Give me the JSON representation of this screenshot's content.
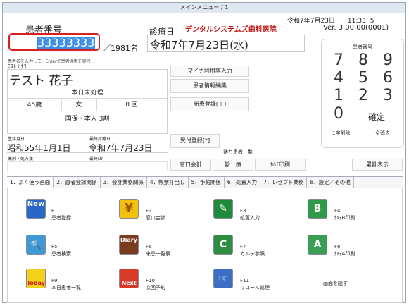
{
  "window": {
    "title": "メインメニュー / 1"
  },
  "header": {
    "date_time": "令和7年7月23日　　11:33: 5",
    "version": "Ver. 3.00.00(0001)",
    "clinic_name": "デンタルシステムズ歯科医院",
    "consult_date_label": "診療日",
    "consult_date": "令和7年7月23日(水)"
  },
  "patient": {
    "number_label": "患者番号",
    "number_value": "33333333",
    "total_count": "／1981名",
    "hint": "患者名を入力して、Enterで患者検索を実行",
    "kana": "ﾃｽﾄ ﾊﾅｺ",
    "name": "テスト 花子",
    "status": "本日未処理",
    "age": "45歳",
    "sex": "女",
    "visits": "0 回",
    "insurance": "国保・本人 3割",
    "birth_label": "生年月日",
    "birth": "昭和55年1月1日",
    "last_visit_label": "最終診療日",
    "last_visit": "令和7年7月23日",
    "disease_label": "薬剤・処方箋",
    "doctor_label": "最終Dr."
  },
  "buttons": {
    "mynumber": "マイナ利用率入力",
    "patient_edit": "患者情報編集",
    "new_patient": "新患登録[＋]",
    "reception": "受付登録[*]",
    "waiting_title": "待ち患者一覧",
    "window_pay": "窓口会計",
    "consult": "診　療",
    "karte_print": "ｶﾙﾃ印刷",
    "cumulative": "累計表示"
  },
  "keypad": {
    "label": "患者番号",
    "keys": [
      "7",
      "8",
      "9",
      "4",
      "5",
      "6",
      "1",
      "2",
      "3",
      "0",
      "確定"
    ],
    "delete_one": "1字削除",
    "delete_all": "全消去"
  },
  "tabs": [
    "1．よく使う画面",
    "2．患者登録関係",
    "3．会計業務関係",
    "4．帳票打出し",
    "5．予約関係",
    "6．処置入力",
    "7．レセプト業務",
    "8．設定／その他"
  ],
  "launchers": [
    {
      "key": "F1",
      "label": "患者登録",
      "icon": "new-icon",
      "icon_text": "New"
    },
    {
      "key": "F2",
      "label": "窓口会計",
      "icon": "yen-icon",
      "icon_text": "¥"
    },
    {
      "key": "F3",
      "label": "処置入力",
      "icon": "treatment-icon",
      "icon_text": "✎"
    },
    {
      "key": "F4",
      "label": "ｶﾙﾃB印刷",
      "icon": "karte-b-icon",
      "icon_text": "B"
    },
    {
      "key": "F5",
      "label": "患者検索",
      "icon": "search-icon",
      "icon_text": "🔍"
    },
    {
      "key": "F6",
      "label": "来患一覧表",
      "icon": "diary-icon",
      "icon_text": "Diary"
    },
    {
      "key": "F7",
      "label": "カルテ参照",
      "icon": "karte-view-icon",
      "icon_text": "C"
    },
    {
      "key": "F8",
      "label": "ｶﾙﾃA印刷",
      "icon": "karte-a-icon",
      "icon_text": "A"
    },
    {
      "key": "F9",
      "label": "本日患者一覧",
      "icon": "today-icon",
      "icon_text": "Today"
    },
    {
      "key": "F10",
      "label": "次回予約",
      "icon": "next-icon",
      "icon_text": "Next"
    },
    {
      "key": "F11",
      "label": "リコール処理",
      "icon": "recall-icon",
      "icon_text": "☞"
    }
  ],
  "hide_screen": "画面を隠す"
}
